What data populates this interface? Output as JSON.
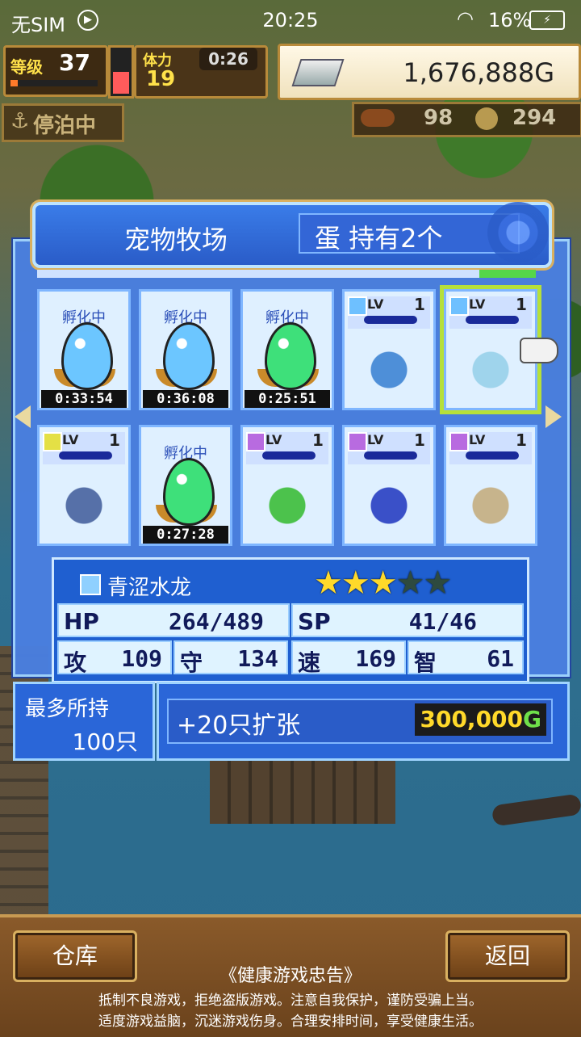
{
  "statusbar": {
    "carrier": "无SIM",
    "time": "20:25",
    "battery": "16%"
  },
  "hud": {
    "level_label": "等级",
    "level": "37",
    "level_progress": 0.08,
    "stamina_label": "体力",
    "stamina": "19",
    "stamina_timer": "0:26",
    "stamina_fill": 0.45,
    "gold": "1,676,888G",
    "dock_status": "停泊中",
    "resource1": "98",
    "resource2": "294"
  },
  "panel": {
    "title": "宠物牧场",
    "egg_count_text": "蛋 持有2个"
  },
  "pets": [
    {
      "kind": "egg",
      "label": "孵化中",
      "timer": "0:33:54",
      "color": "#6cc6ff"
    },
    {
      "kind": "egg",
      "label": "孵化中",
      "timer": "0:36:08",
      "color": "#6cc6ff"
    },
    {
      "kind": "egg",
      "label": "孵化中",
      "timer": "0:25:51",
      "color": "#3ee07a"
    },
    {
      "kind": "monster",
      "lv_label": "LV",
      "level": "1",
      "element_color": "#6ec0ff",
      "name_icon": "shark-icon",
      "sprite_color": "#4e8fd8"
    },
    {
      "kind": "monster",
      "lv_label": "LV",
      "level": "1",
      "element_color": "#6ec0ff",
      "name_icon": "water-dragon-icon",
      "sprite_color": "#9fd4ec",
      "selected": true
    },
    {
      "kind": "monster",
      "lv_label": "LV",
      "level": "1",
      "element_color": "#e4e045",
      "name_icon": "bird-icon",
      "sprite_color": "#5670a8"
    },
    {
      "kind": "egg",
      "label": "孵化中",
      "timer": "0:27:28",
      "color": "#3ee07a"
    },
    {
      "kind": "monster",
      "lv_label": "LV",
      "level": "1",
      "element_color": "#b86be0",
      "name_icon": "goblin-icon",
      "sprite_color": "#4cc24c"
    },
    {
      "kind": "monster",
      "lv_label": "LV",
      "level": "1",
      "element_color": "#b86be0",
      "name_icon": "wizard-icon",
      "sprite_color": "#3a50c8"
    },
    {
      "kind": "monster",
      "lv_label": "LV",
      "level": "1",
      "element_color": "#b86be0",
      "name_icon": "mummy-icon",
      "sprite_color": "#c7b48c"
    }
  ],
  "selected_pet": {
    "name": "青涩水龙",
    "stars": 3,
    "max_stars": 5,
    "stats": {
      "hp_label": "HP",
      "hp": "264/489",
      "sp_label": "SP",
      "sp": "41/46",
      "atk_label": "攻",
      "atk": "109",
      "def_label": "守",
      "def": "134",
      "spd_label": "速",
      "spd": "169",
      "int_label": "智",
      "int": "61"
    }
  },
  "capacity": {
    "max_label": "最多所持",
    "max_value": "100只",
    "expand_label": "+20只扩张",
    "expand_price": "300,000",
    "price_unit": "G"
  },
  "buttons": {
    "warehouse": "仓库",
    "back": "返回"
  },
  "notice": {
    "title": "《健康游戏忠告》",
    "line1": "抵制不良游戏，拒绝盗版游戏。注意自我保护，谨防受骗上当。",
    "line2": "适度游戏益脑，沉迷游戏伤身。合理安排时间，享受健康生活。"
  }
}
